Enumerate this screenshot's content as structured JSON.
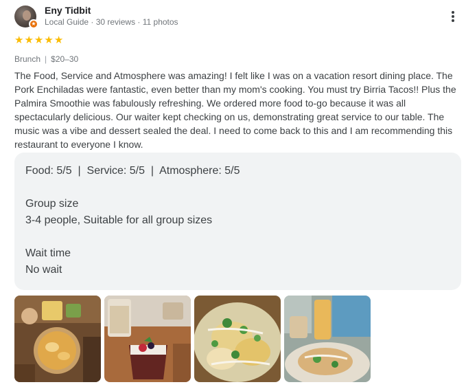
{
  "reviewer": {
    "name": "Eny Tidbit",
    "meta": "Local Guide · 30 reviews · 11 photos"
  },
  "rating": {
    "stars": 5,
    "max": 5
  },
  "tags": {
    "meal": "Brunch",
    "price": "$20–30"
  },
  "review_text": "The Food, Service and Atmosphere was amazing! I felt like I was on a vacation resort dining place. The Pork Enchiladas were fantastic, even better than my mom's cooking. You must try Birria Tacos!! Plus the Palmira Smoothie was fabulously refreshing. We ordered more food to-go because it was all spectacularly delicious. Our waiter kept checking on us, demonstrating great service to our table. The music was a vibe and dessert sealed the deal. I need to come back to this and I am recommending this restaurant to everyone I know.",
  "details": {
    "scores": "Food: 5/5  |  Service: 5/5  |  Atmosphere: 5/5",
    "group_size_label": "Group size",
    "group_size_value": "3-4 people, Suitable for all group sizes",
    "wait_time_label": "Wait time",
    "wait_time_value": "No wait"
  },
  "photos": [
    {
      "subject": "pork enchiladas bowl on wooden board"
    },
    {
      "subject": "smoothie and berry dessert cup"
    },
    {
      "subject": "birria tacos platter with jalapeños"
    },
    {
      "subject": "drinks and plated food on table"
    }
  ],
  "colors": {
    "star": "#fbbc04",
    "badge": "#e8710a",
    "card_bg": "#f1f3f4"
  }
}
